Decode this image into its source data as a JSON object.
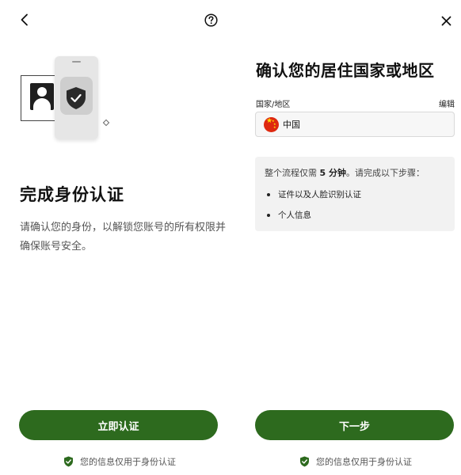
{
  "left": {
    "title": "完成身份认证",
    "description": "请确认您的身份，以解锁您账号的所有权限并确保账号安全。",
    "verify_button": "立即认证",
    "footer_note": "您的信息仅用于身份认证",
    "back_icon": "chevron-left-icon",
    "help_icon": "question-circle-icon"
  },
  "right": {
    "title": "确认您的居住国家或地区",
    "field_label": "国家/地区",
    "edit_label": "编辑",
    "country": {
      "name": "中国",
      "flag_icon": "china-flag-icon"
    },
    "info": {
      "intro_prefix": "整个流程仅需 ",
      "intro_duration": "5 分钟",
      "intro_suffix": "。请完成以下步骤：",
      "steps": [
        "证件以及人脸识别认证",
        "个人信息"
      ]
    },
    "next_button": "下一步",
    "footer_note": "您的信息仅用于身份认证",
    "close_icon": "close-icon"
  },
  "colors": {
    "primary": "#2d6a1e",
    "shield": "#2d6a1e",
    "info_bg": "#f2f2f2"
  }
}
